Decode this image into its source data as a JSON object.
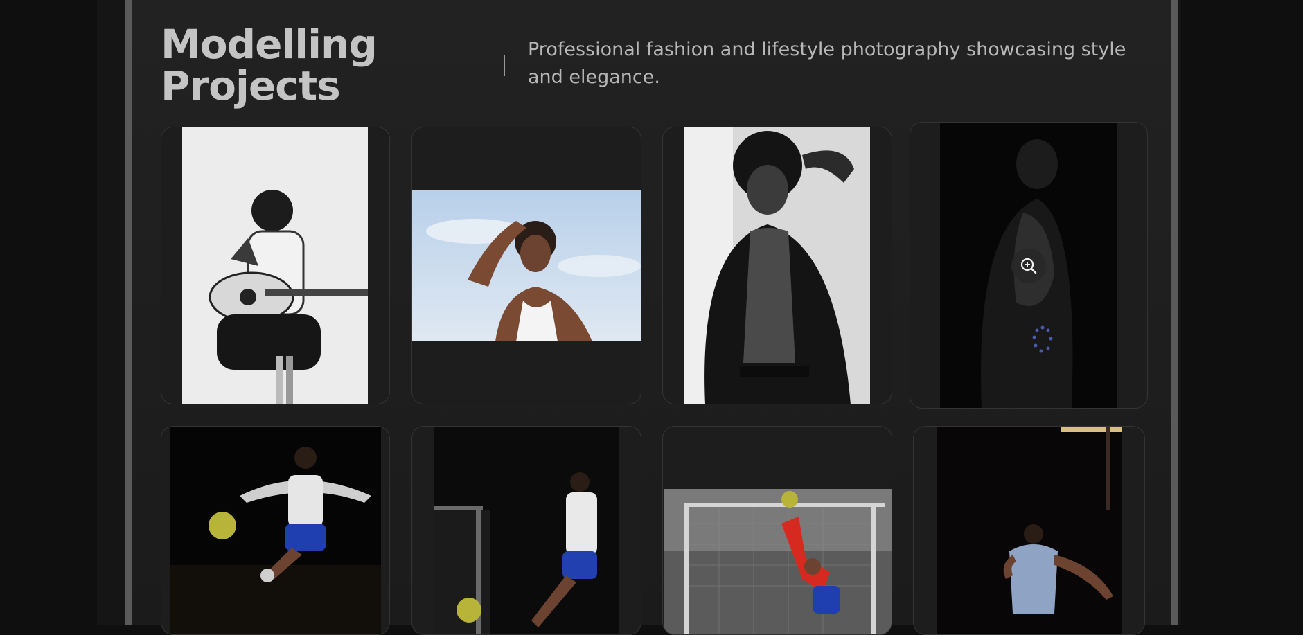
{
  "header": {
    "title_line1": "Modelling",
    "title_line2": "Projects",
    "description": "Professional fashion and lifestyle photography showcasing style and elegance."
  },
  "gallery": {
    "photos": [
      {
        "subject": "Man with acoustic guitar seated on stool, black and white"
      },
      {
        "subject": "Man in white tank top with hand on head against blue sky"
      },
      {
        "subject": "Man in open black shirt, black and white"
      },
      {
        "subject": "Shirtless man in low light"
      },
      {
        "subject": "Footballer mid-air kick in dark"
      },
      {
        "subject": "Footballer with ball near goal, dark"
      },
      {
        "subject": "Goalkeeper in red reaching for ball"
      },
      {
        "subject": "Footballer in light kit, dark indoor court"
      }
    ],
    "zoom_icon": "zoom-in-icon"
  },
  "colors": {
    "background": "#0f0f0f",
    "panel": "#1e1e1e",
    "rail": "#5a5a5a",
    "title": "#c4c4c4",
    "description": "#b7b7b7"
  }
}
